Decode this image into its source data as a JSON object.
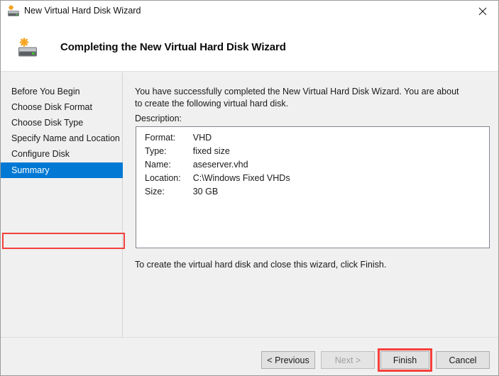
{
  "window": {
    "title": "New Virtual Hard Disk Wizard",
    "title_icon": "hard-disk-new-icon",
    "close_icon": "close-icon"
  },
  "header": {
    "icon": "hard-disk-new-icon",
    "title": "Completing the New Virtual Hard Disk Wizard"
  },
  "sidebar": {
    "items": [
      {
        "label": "Before You Begin",
        "selected": false
      },
      {
        "label": "Choose Disk Format",
        "selected": false
      },
      {
        "label": "Choose Disk Type",
        "selected": false
      },
      {
        "label": "Specify Name and Location",
        "selected": false
      },
      {
        "label": "Configure Disk",
        "selected": false
      },
      {
        "label": "Summary",
        "selected": true
      }
    ]
  },
  "content": {
    "intro_text": "You have successfully completed the New Virtual Hard Disk Wizard. You are about to create the following virtual hard disk.",
    "description_label": "Description:",
    "summary_rows": [
      {
        "key": "Format:",
        "value": "VHD"
      },
      {
        "key": "Type:",
        "value": "fixed size"
      },
      {
        "key": "Name:",
        "value": "aseserver.vhd"
      },
      {
        "key": "Location:",
        "value": "C:\\Windows Fixed VHDs"
      },
      {
        "key": "Size:",
        "value": "30 GB"
      }
    ],
    "closing_text": "To create the virtual hard disk and close this wizard, click Finish."
  },
  "footer": {
    "buttons": [
      {
        "label": "< Previous",
        "disabled": false
      },
      {
        "label": "Next >",
        "disabled": true
      },
      {
        "label": "Finish",
        "disabled": false
      },
      {
        "label": "Cancel",
        "disabled": false
      }
    ]
  },
  "annotations": {
    "color": "#f4403b",
    "targets": [
      "Summary",
      "Finish"
    ]
  }
}
